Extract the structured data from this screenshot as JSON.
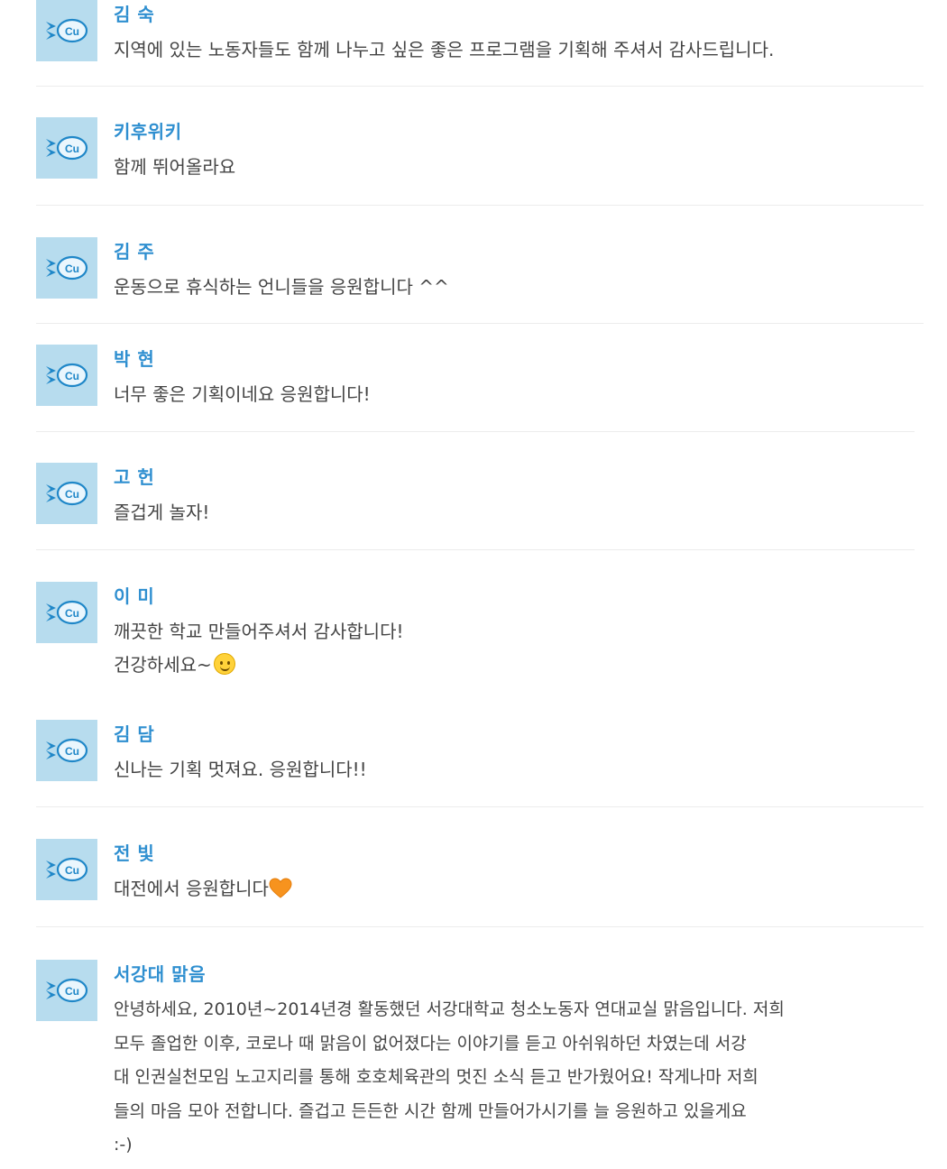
{
  "colors": {
    "name": "#2f8fd0",
    "avatar_bg": "#b7dcee",
    "text": "#444444",
    "divider": "#ececec"
  },
  "comments": [
    {
      "name": "김 숙",
      "lines": [
        "지역에 있는 노동자들도 함께 나누고 싶은 좋은 프로그램을 기획해 주셔서 감사드립니다."
      ]
    },
    {
      "name": "키후위키",
      "lines": [
        "함께 뛰어올라요"
      ]
    },
    {
      "name": "김 주",
      "lines": [
        "운동으로 휴식하는 언니들을 응원합니다 ^^"
      ]
    },
    {
      "name": "박 현",
      "lines": [
        "너무 좋은 기획이네요 응원합니다!"
      ]
    },
    {
      "name": "고 헌",
      "lines": [
        "즐겁게 놀자!"
      ]
    },
    {
      "name": "이 미",
      "lines": [
        "깨끗한 학교 만들어주셔서 감사합니다!",
        "건강하세요~"
      ]
    },
    {
      "name": "김 담",
      "lines": [
        "신나는 기획 멋져요. 응원합니다!!"
      ]
    },
    {
      "name": "전 빛",
      "lines": [
        "대전에서 응원합니다"
      ]
    },
    {
      "name": "서강대 맑음",
      "lines": [
        "안녕하세요, 2010년~2014년경 활동했던 서강대학교 청소노동자 연대교실 맑음입니다. 저희",
        "모두 졸업한 이후, 코로나 때 맑음이 없어졌다는 이야기를 듣고 아쉬워하던 차였는데 서강",
        "대 인권실천모임 노고지리를 통해 호호체육관의 멋진 소식 듣고 반가웠어요! 작게나마 저희",
        "들의 마음 모아 전합니다. 즐겁고 든든한 시간 함께 만들어가시기를 늘 응원하고 있을게요",
        ":-)"
      ]
    }
  ]
}
